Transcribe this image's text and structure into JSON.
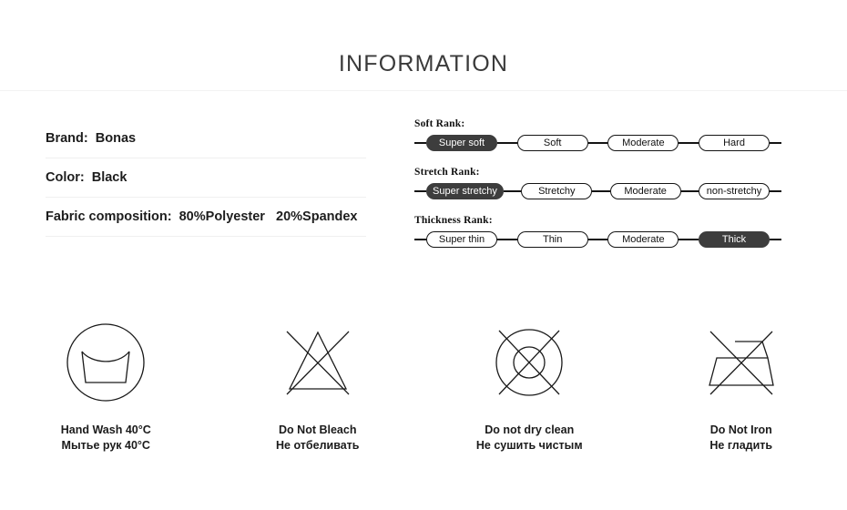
{
  "header": {
    "title": "INFORMATION"
  },
  "info": {
    "rows": [
      {
        "text": "Brand:  Bonas"
      },
      {
        "text": "Color:  Black"
      },
      {
        "text": "Fabric composition:  80%Polyester   20%Spandex"
      }
    ]
  },
  "ranks": {
    "selected_color": "#3d3d3d",
    "track_color": "#141414",
    "blocks": [
      {
        "label": "Soft Rank:",
        "options": [
          {
            "label": "Super soft",
            "selected": true
          },
          {
            "label": "Soft",
            "selected": false
          },
          {
            "label": "Moderate",
            "selected": false
          },
          {
            "label": "Hard",
            "selected": false
          }
        ]
      },
      {
        "label": "Stretch Rank:",
        "options": [
          {
            "label": "Super stretchy",
            "selected": true
          },
          {
            "label": "Stretchy",
            "selected": false
          },
          {
            "label": "Moderate",
            "selected": false
          },
          {
            "label": "non-stretchy",
            "selected": false
          }
        ]
      },
      {
        "label": "Thickness Rank:",
        "options": [
          {
            "label": "Super thin",
            "selected": false
          },
          {
            "label": "Thin",
            "selected": false
          },
          {
            "label": "Moderate",
            "selected": false
          },
          {
            "label": "Thick",
            "selected": true
          }
        ]
      }
    ]
  },
  "care": {
    "items": [
      {
        "icon": "hand-wash-icon",
        "en": "Hand Wash 40°C",
        "ru": "Мытье рук 40°C"
      },
      {
        "icon": "do-not-bleach-icon",
        "en": "Do Not Bleach",
        "ru": "Не отбеливать"
      },
      {
        "icon": "do-not-dry-clean-icon",
        "en": "Do not dry clean",
        "ru": "Не сушить чистым"
      },
      {
        "icon": "do-not-iron-icon",
        "en": "Do Not Iron",
        "ru": "Не гладить"
      }
    ]
  }
}
